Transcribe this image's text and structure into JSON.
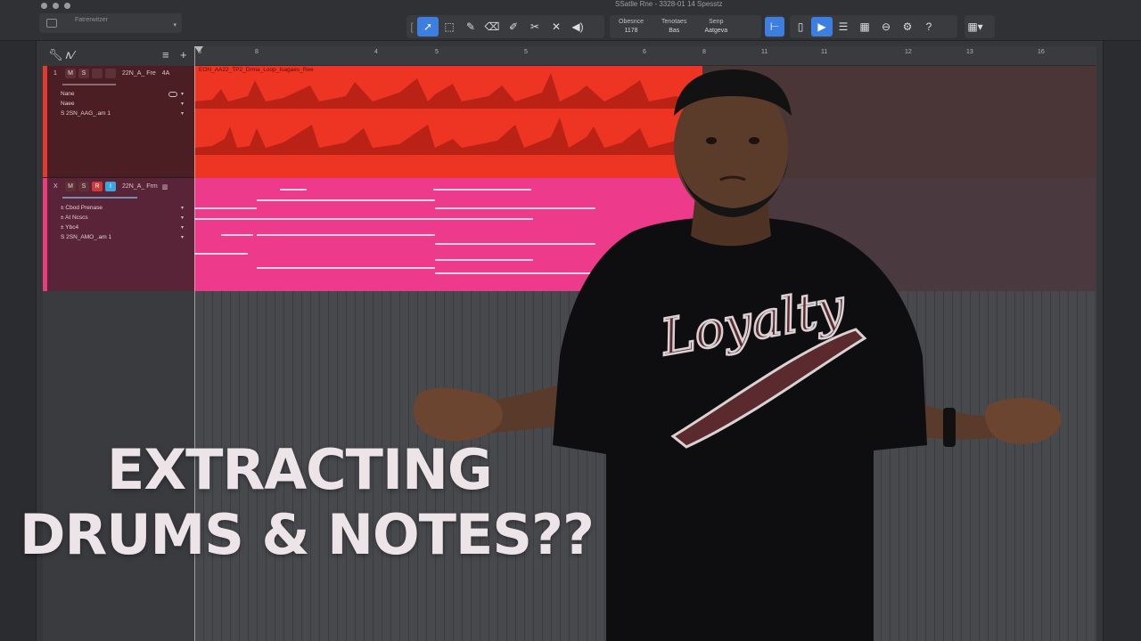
{
  "window": {
    "title": "SSatlle Rne - 3328-01 14 Spesstz"
  },
  "project": {
    "name": "Fatrerwitzer"
  },
  "toolbar": {
    "tools": [
      "pointer-tool",
      "marquee-tool",
      "pencil-tool",
      "eraser-tool",
      "knife-tool",
      "brush-tool",
      "mute-tool",
      "listen-tool"
    ],
    "selectors": [
      {
        "label": "Obesnce",
        "value": "1178"
      },
      {
        "label": "Tenotaes",
        "value": "Bas"
      },
      {
        "label": "Senp",
        "value": "Aatgeva"
      }
    ],
    "help": "?"
  },
  "ruler": {
    "ticks": [
      "3",
      "8",
      "4",
      "5",
      "5",
      "6",
      "8",
      "11",
      "11",
      "12",
      "13",
      "16"
    ]
  },
  "tracks": [
    {
      "num": "1",
      "mute": "M",
      "solo": "S",
      "name": "22N_A_ Fre",
      "meter": "4A",
      "region_title": "EON_AA22_TP2_Drma_Loop_Isagaes_Ree",
      "params": [
        {
          "label": "Nane",
          "value": ""
        },
        {
          "label": "Naee",
          "value": ""
        },
        {
          "label": "2SN_AAG_.am 1",
          "value": ""
        }
      ],
      "param_prefix": [
        "",
        "",
        "S"
      ]
    },
    {
      "num": "X",
      "mute": "M",
      "solo": "S",
      "rec": "R",
      "input": "I",
      "name": "22N_A_ Frm",
      "params": [
        {
          "label": "Cbod Prenase"
        },
        {
          "label": "At Ncscs"
        },
        {
          "label": "Ybc4"
        },
        {
          "label": "2SN_AMO_.am 1"
        }
      ],
      "param_prefix": [
        "±",
        "±",
        "±",
        "S"
      ]
    }
  ],
  "caption": {
    "line1": "EXTRACTING",
    "line2": "DRUMS & NOTES??"
  },
  "shirt": {
    "text": "Loyalty"
  },
  "colors": {
    "drum_region": "#ee3523",
    "midi_region": "#ee3a8a",
    "accent": "#3d7fe0"
  }
}
